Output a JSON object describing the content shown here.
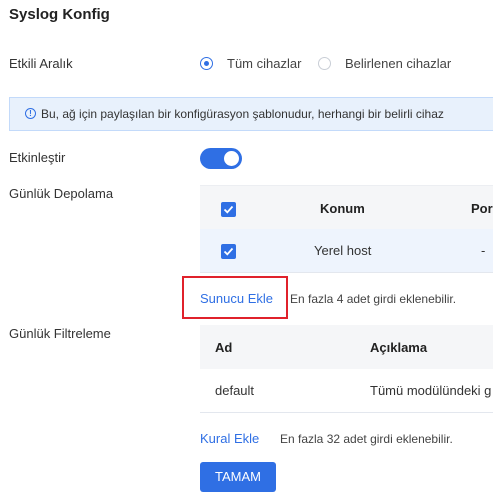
{
  "page_title": "Syslog Konfig",
  "effective_range": {
    "label": "Etkili Aralık",
    "options": [
      {
        "label": "Tüm cihazlar",
        "selected": true
      },
      {
        "label": "Belirlenen cihazlar",
        "selected": false
      }
    ]
  },
  "info_banner": {
    "icon": "info-icon",
    "text": "Bu, ağ için paylaşılan bir konfigürasyon şablonudur, herhangi bir belirli cihaz"
  },
  "enable": {
    "label": "Etkinleştir",
    "on": true
  },
  "log_storage": {
    "label": "Günlük Depolama",
    "columns": [
      "Konum",
      "Por"
    ],
    "rows": [
      {
        "checked": true,
        "location": "Yerel host",
        "port": "-"
      }
    ],
    "add_server_label": "Sunucu Ekle",
    "hint": "En fazla 4 adet girdi eklenebilir."
  },
  "log_filter": {
    "label": "Günlük Filtreleme",
    "columns": [
      "Ad",
      "Açıklama"
    ],
    "rows": [
      {
        "name": "default",
        "description": "Tümü modülündeki g"
      }
    ],
    "add_rule_label": "Kural Ekle",
    "hint": "En fazla 32 adet girdi eklenebilir."
  },
  "ok_button": "TAMAM",
  "colors": {
    "accent": "#2f6fe4",
    "highlight": "#e0212b",
    "banner_bg": "#e8f1fc"
  }
}
